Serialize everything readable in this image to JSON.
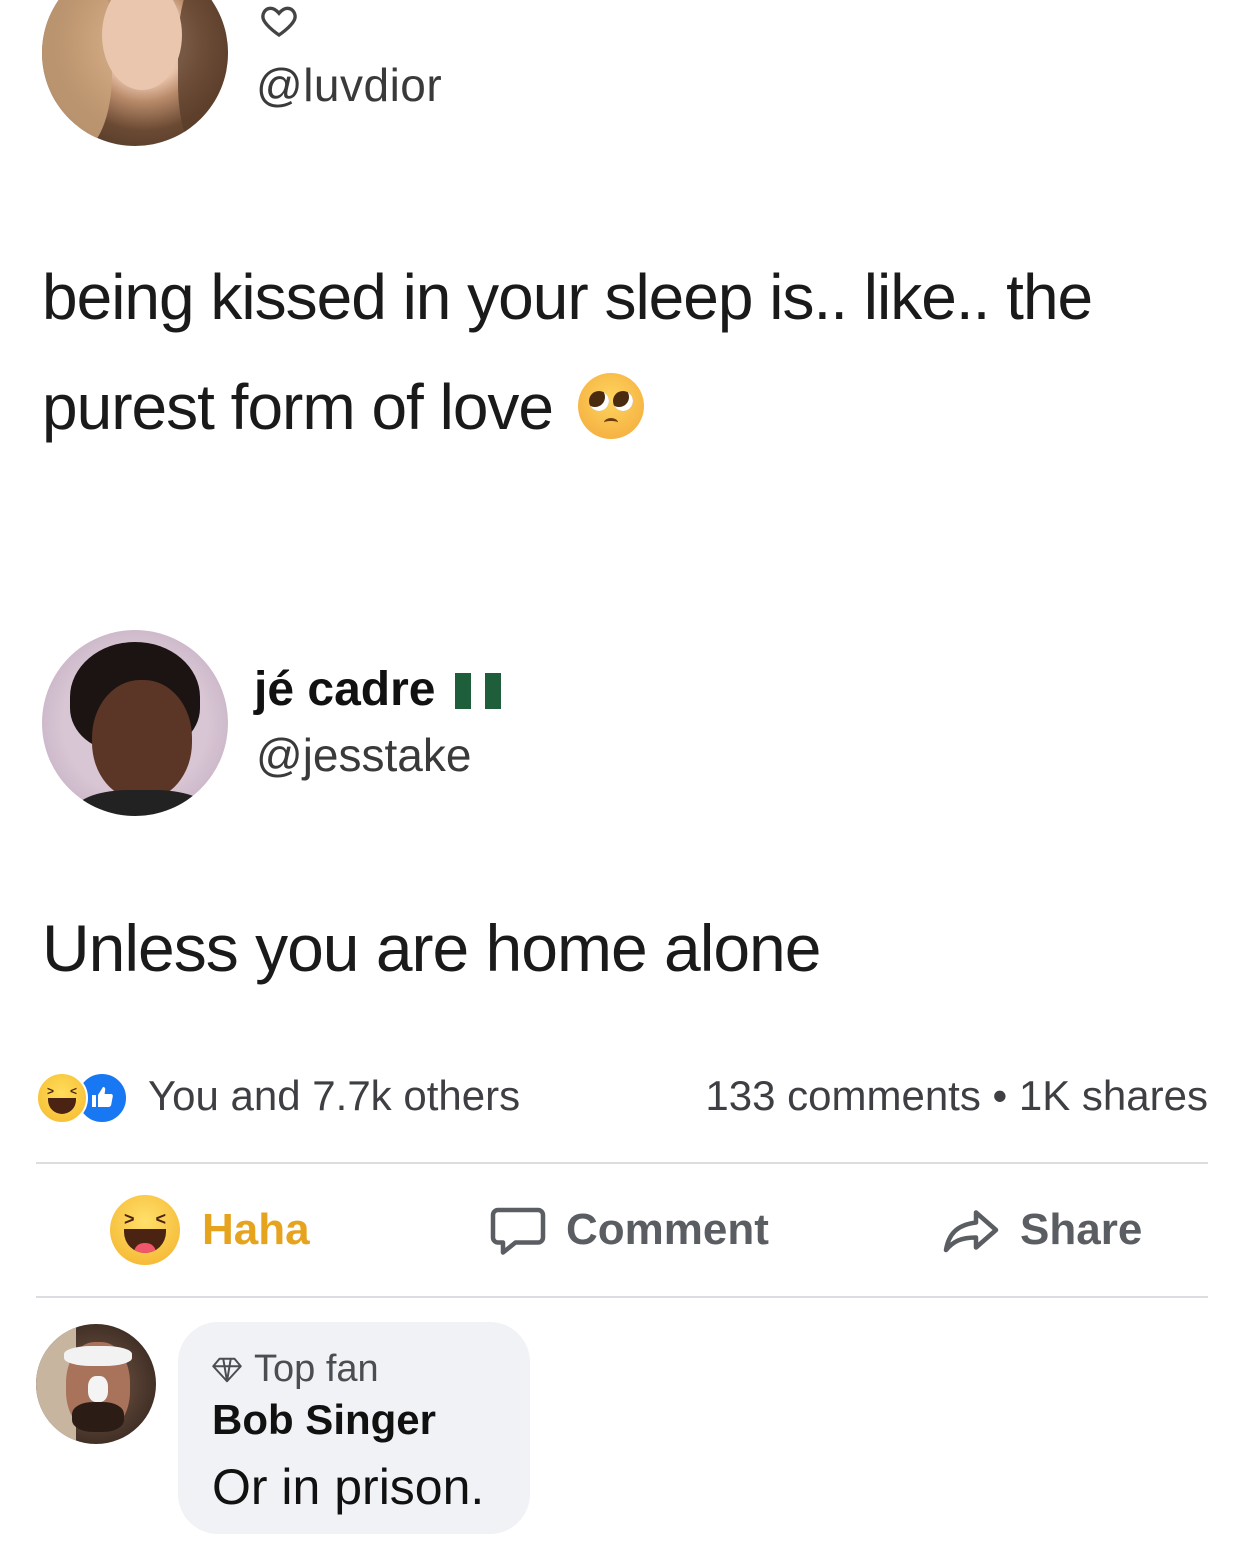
{
  "tweet1": {
    "handle": "@luvdior",
    "text_line1": "being kissed in your sleep is.. like.. the",
    "text_line2": "purest form of love",
    "emoji": "pleading-face-emoji"
  },
  "tweet2": {
    "name": "jé cadre",
    "flag": "nigeria-flag",
    "handle": "@jesstake",
    "text": "Unless you are home alone"
  },
  "facebook": {
    "reactions_summary": "You and 7.7k others",
    "counts": "133 comments • 1K shares",
    "actions": {
      "haha": "Haha",
      "comment": "Comment",
      "share": "Share"
    },
    "colors": {
      "haha_active": "#e6a31e",
      "like_blue": "#1877f2",
      "comment_bg": "#f0f2f5"
    }
  },
  "comment": {
    "badge": "Top fan",
    "author": "Bob Singer",
    "text": "Or in prison."
  }
}
